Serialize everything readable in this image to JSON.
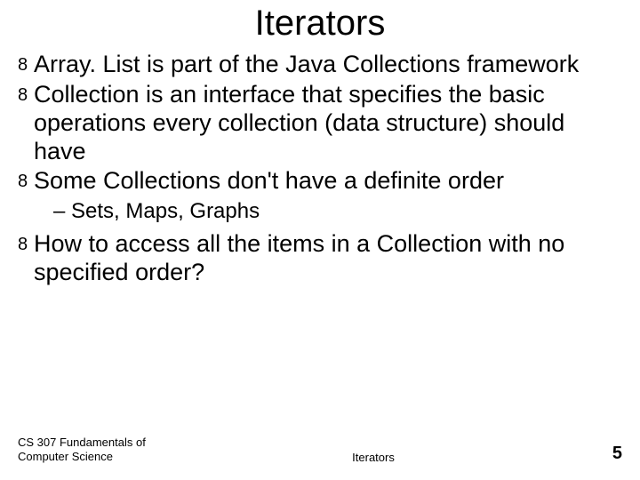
{
  "title": "Iterators",
  "bullets": [
    {
      "text": "Array. List is part of the Java Collections framework"
    },
    {
      "text": "Collection is an interface that specifies the basic operations every collection (data structure) should have"
    },
    {
      "text": "Some Collections don't have a definite order",
      "sub": "– Sets, Maps, Graphs"
    },
    {
      "text": "How to access all the items in a Collection with no specified order?"
    }
  ],
  "footer": {
    "left": "CS 307 Fundamentals of Computer Science",
    "center": "Iterators",
    "page": "5"
  },
  "marker": "8"
}
